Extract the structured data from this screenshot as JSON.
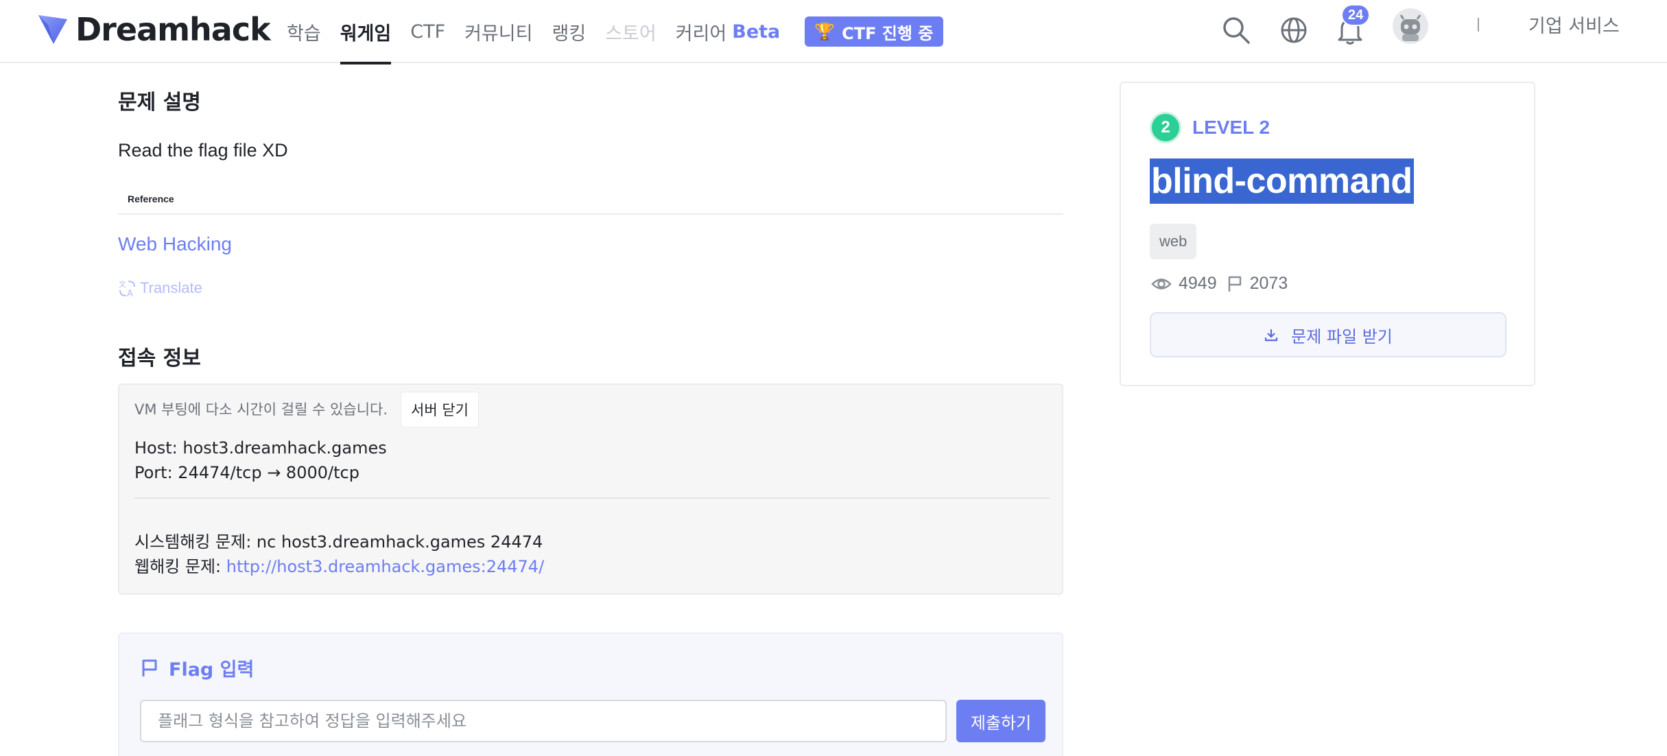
{
  "header": {
    "logo_text": "Dreamhack",
    "nav": [
      {
        "label": "학습"
      },
      {
        "label": "워게임"
      },
      {
        "label": "CTF"
      },
      {
        "label": "커뮤니티"
      },
      {
        "label": "랭킹"
      },
      {
        "label": "스토어"
      },
      {
        "label": "커리어"
      }
    ],
    "career_beta": "Beta",
    "ctf_badge": "CTF 진행 중",
    "notification_count": "24",
    "biz_link": "기업 서비스",
    "icons": [
      "search-icon",
      "globe-icon",
      "bell-icon",
      "avatar"
    ]
  },
  "description": {
    "title": "문제 설명",
    "text": "Read the flag file XD",
    "reference_label": "Reference",
    "reference_link": "Web Hacking",
    "translate": "Translate"
  },
  "connection": {
    "title": "접속 정보",
    "vm_note": "VM 부팅에 다소 시간이 걸릴 수 있습니다.",
    "close_button": "서버 닫기",
    "host": "Host: host3.dreamhack.games",
    "port": "Port:  24474/tcp → 8000/tcp",
    "system_label": "시스템해킹 문제: nc host3.dreamhack.games 24474",
    "web_label": "웹해킹 문제: ",
    "web_url": "http://host3.dreamhack.games:24474/"
  },
  "flag": {
    "title": "Flag 입력",
    "placeholder": "플래그 형식을 참고하여 정답을 입력해주세요",
    "value": "",
    "submit": "제출하기"
  },
  "challenge": {
    "level_number": "2",
    "level_text": "LEVEL 2",
    "name": "blind-command",
    "tag": "web",
    "views": "4949",
    "solves": "2073",
    "download": "문제 파일 받기"
  },
  "colors": {
    "accent": "#6d7ef2",
    "level_green": "#2ccf95",
    "selection": "#3a66d1"
  }
}
